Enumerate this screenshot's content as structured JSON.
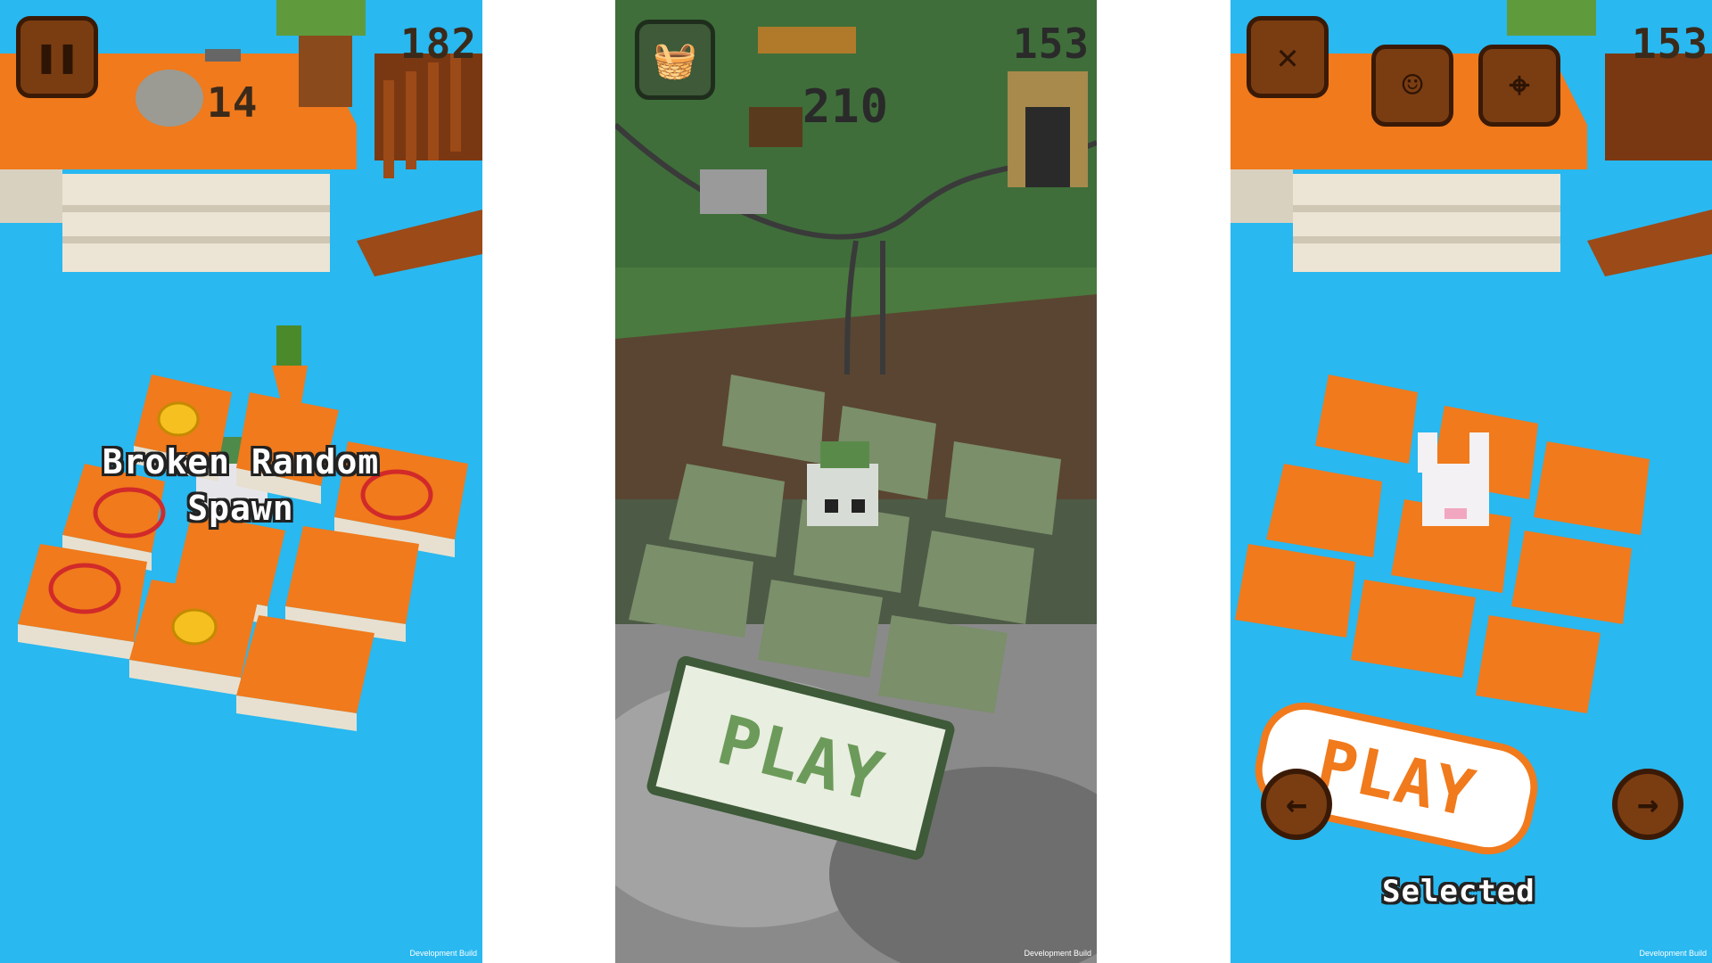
{
  "panel_left": {
    "pause_icon": "pause-icon",
    "score": "182",
    "count": "14",
    "message_line1": "Broken Random",
    "message_line2": "Spawn",
    "dev_label": "Development Build"
  },
  "panel_middle": {
    "basket_icon": "basket-icon",
    "score": "153",
    "count": "210",
    "play_label": "PLAY",
    "dev_label": "Development Build"
  },
  "panel_right": {
    "close_icon": "close-icon",
    "character_icon": "character-icon",
    "map_icon": "map-pin-icon",
    "score": "153",
    "play_label": "PLAY",
    "prev_icon": "arrow-left-icon",
    "next_icon": "arrow-right-icon",
    "status_text": "Selected",
    "dev_label": "Development Build"
  }
}
